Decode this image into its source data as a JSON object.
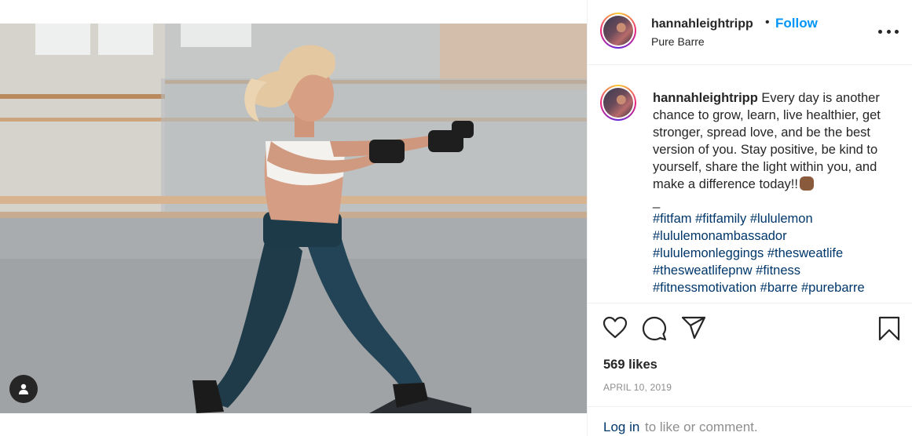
{
  "post": {
    "username": "hannahleightripp",
    "separator": "•",
    "follow_label": "Follow",
    "location": "Pure Barre",
    "more_icon": "more-options-icon"
  },
  "caption": {
    "username": "hannahleightripp",
    "text": " Every day is another chance to grow, learn, live healthier, get stronger, spread love, and be the best version of you. Stay positive, be kind to yourself, share the light within you, and make a difference today!!",
    "emoji": "fist-emoji",
    "divider": "_",
    "hashtags": [
      "#fitfam",
      "#fitfamily",
      "#lululemon",
      "#lululemonambassador",
      "#lululemonleggings",
      "#thesweatlife",
      "#thesweatlifepnw",
      "#fitness",
      "#fitnessmotivation",
      "#barre",
      "#purebarre"
    ]
  },
  "actions": {
    "like_icon": "heart-icon",
    "comment_icon": "comment-icon",
    "share_icon": "share-icon",
    "save_icon": "bookmark-icon"
  },
  "likes_text": "569 likes",
  "date_text": "APRIL 10, 2019",
  "login": {
    "link_label": "Log in",
    "rest_text": " to like or comment."
  },
  "colors": {
    "follow_blue": "#0095f6",
    "hashtag_link": "#00376b",
    "muted_gray": "#8e8e8e"
  }
}
